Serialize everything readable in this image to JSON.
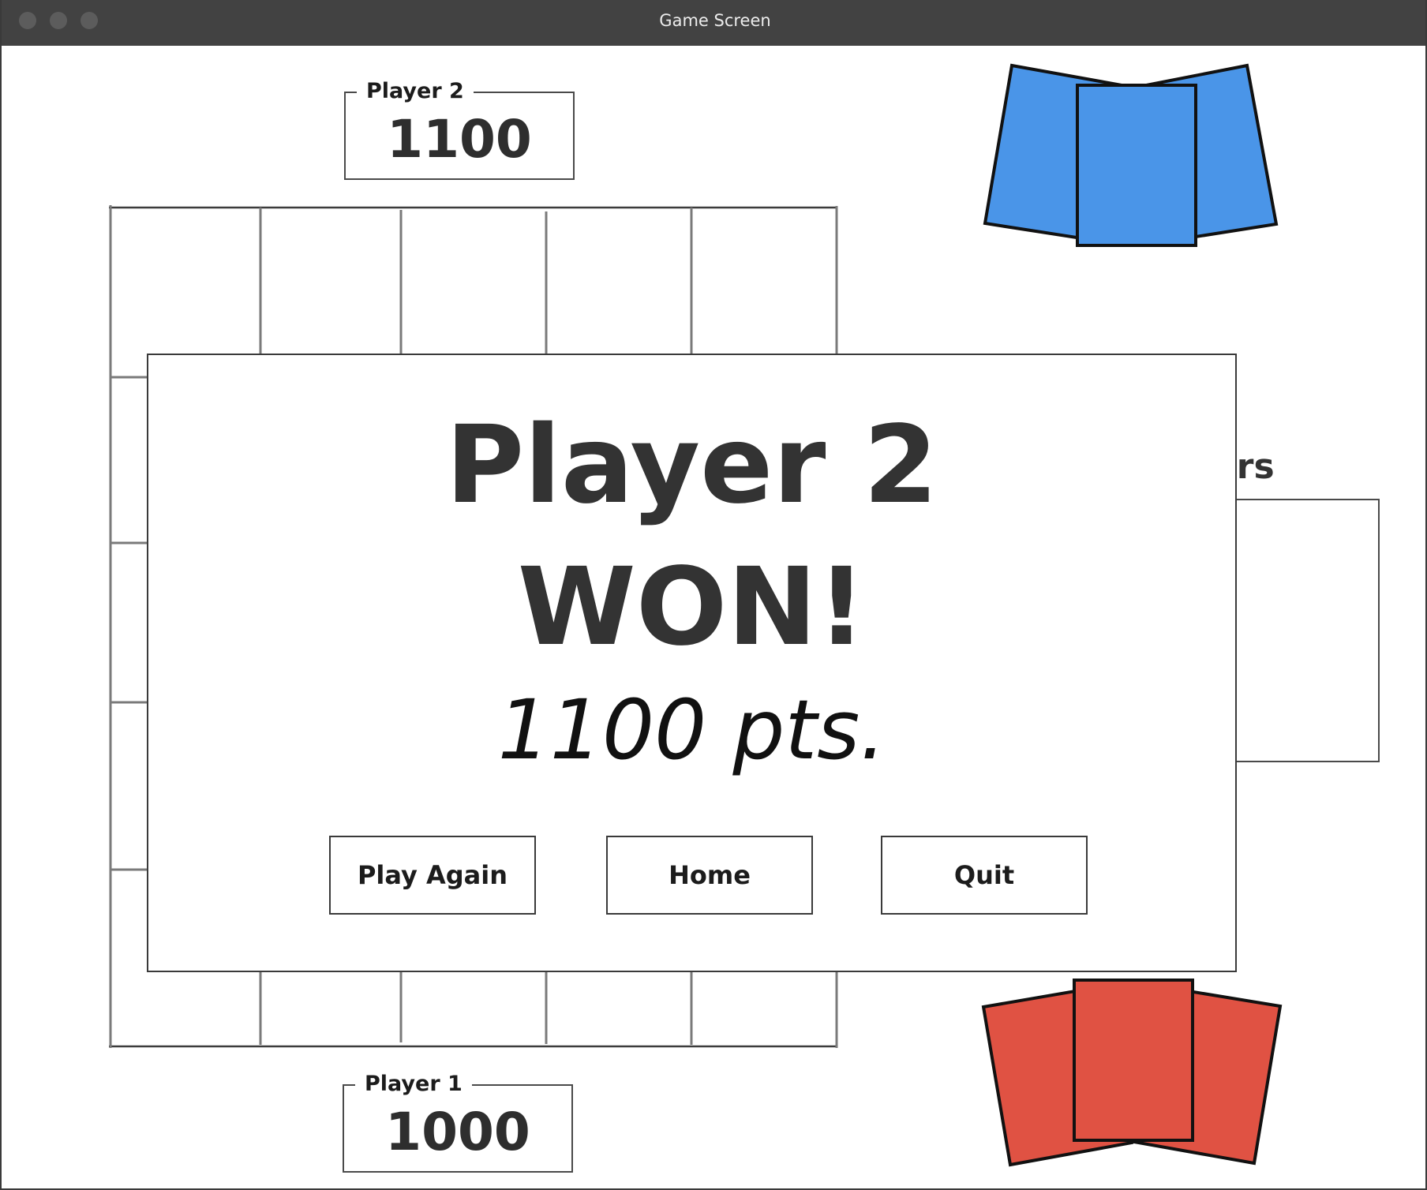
{
  "window": {
    "title": "Game Screen"
  },
  "players": {
    "player2": {
      "label": "Player 2",
      "score": "1100"
    },
    "player1": {
      "label": "Player 1",
      "score": "1000"
    }
  },
  "pairs_panel": {
    "label": "Pairs",
    "visible_label": "airs"
  },
  "hands": {
    "player2_color": "#4a95e8",
    "player1_color": "#e05243"
  },
  "result_dialog": {
    "title": "Player 2 WON!",
    "title_line1": "Player 2",
    "title_line2": "WON!",
    "score_text": "1100 pts.",
    "buttons": {
      "play_again": "Play Again",
      "home": "Home",
      "quit": "Quit"
    }
  }
}
